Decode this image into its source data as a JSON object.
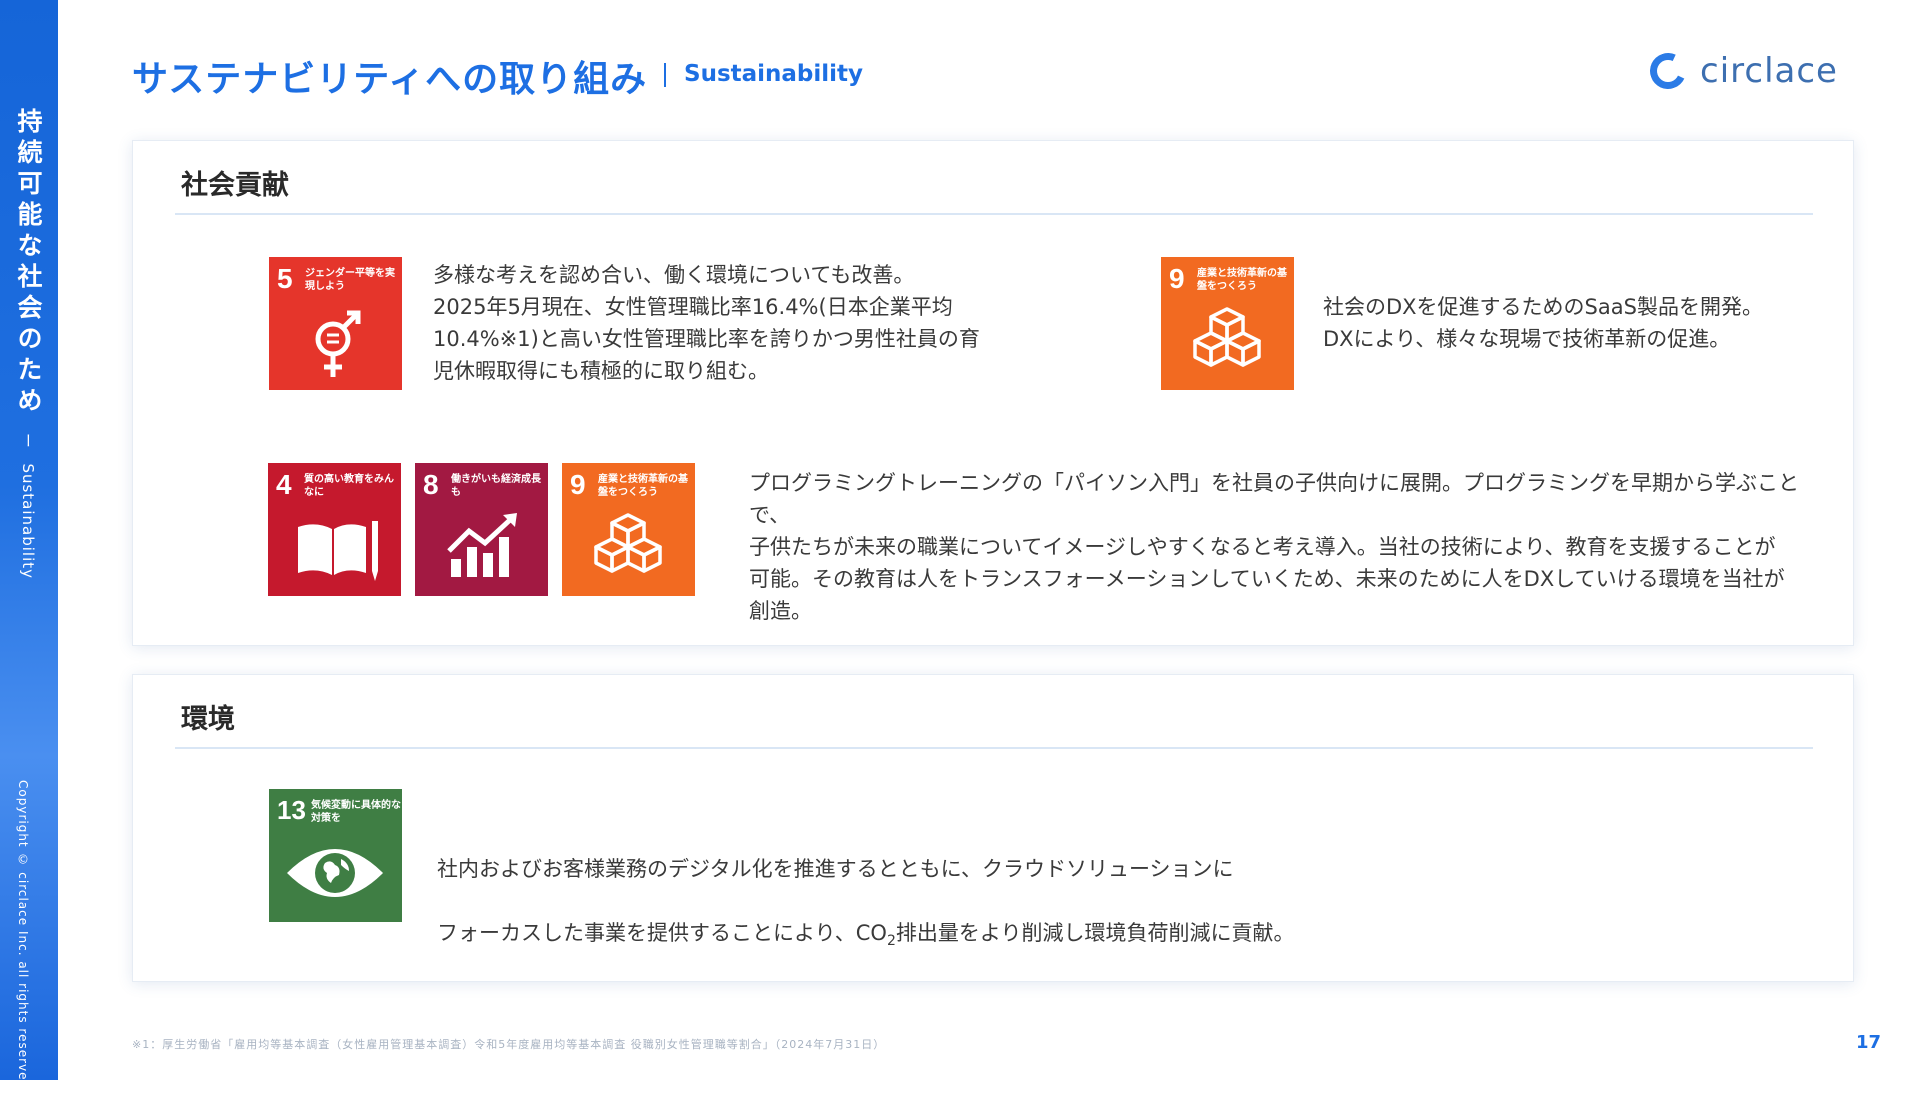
{
  "sidebar": {
    "title": "持続可能な社会のため",
    "separator": "ー",
    "subtitle": "Sustainability",
    "copyright": "Copyright © circlace Inc. all rights reserved."
  },
  "header": {
    "title": "サステナビリティへの取り組み",
    "subtitle": "Sustainability",
    "logo_text": "circlace",
    "logo_color": "#2b7be6"
  },
  "sections": {
    "social": {
      "heading": "社会貢献",
      "items": [
        {
          "text": "多様な考えを認め合い、働く環境についても改善。\n2025年5月現在、女性管理職比率16.4%(日本企業平均\n10.4%※1)と高い女性管理職比率を誇りかつ男性社員の育\n児休暇取得にも積極的に取り組む。",
          "sdgs": [
            {
              "number": "5",
              "label": "ジェンダー平等を実現しよう",
              "color": "#e5352b",
              "icon": "gender-equality-icon"
            }
          ]
        },
        {
          "text": "社会のDXを促進するためのSaaS製品を開発。\nDXにより、様々な現場で技術革新の促進。",
          "sdgs": [
            {
              "number": "9",
              "label": "産業と技術革新の基盤をつくろう",
              "color": "#f26a21",
              "icon": "industry-cubes-icon"
            }
          ]
        },
        {
          "text": "プログラミングトレーニングの「パイソン入門」を社員の子供向けに展開。プログラミングを早期から学ぶことで、\n子供たちが未来の職業についてイメージしやすくなると考え導入。当社の技術により、教育を支援することが\n可能。その教育は人をトランスフォーメーションしていくため、未来のために人をDXしていける環境を当社が\n創造。",
          "sdgs": [
            {
              "number": "4",
              "label": "質の高い教育をみんなに",
              "color": "#c5192d",
              "icon": "education-book-icon"
            },
            {
              "number": "8",
              "label": "働きがいも経済成長も",
              "color": "#a21942",
              "icon": "growth-chart-icon"
            },
            {
              "number": "9",
              "label": "産業と技術革新の基盤をつくろう",
              "color": "#f26a21",
              "icon": "industry-cubes-icon"
            }
          ]
        }
      ]
    },
    "environment": {
      "heading": "環境",
      "text_line1": "社内およびお客様業務のデジタル化を推進するとともに、クラウドソリューションに",
      "text_line2_a": "フォーカスした事業を提供することにより、CO",
      "text_line2_sub": "2",
      "text_line2_b": "排出量をより削減し環境負荷削減に貢献。",
      "sdgs": [
        {
          "number": "13",
          "label": "気候変動に具体的な対策を",
          "color": "#3f7e44",
          "icon": "climate-eye-icon"
        }
      ]
    }
  },
  "footnote": "※1：厚生労働省「雇用均等基本調査（女性雇用管理基本調査）令和5年度雇用均等基本調査 役職別女性管理職等割合」（2024年7月31日）",
  "page_number": "17"
}
